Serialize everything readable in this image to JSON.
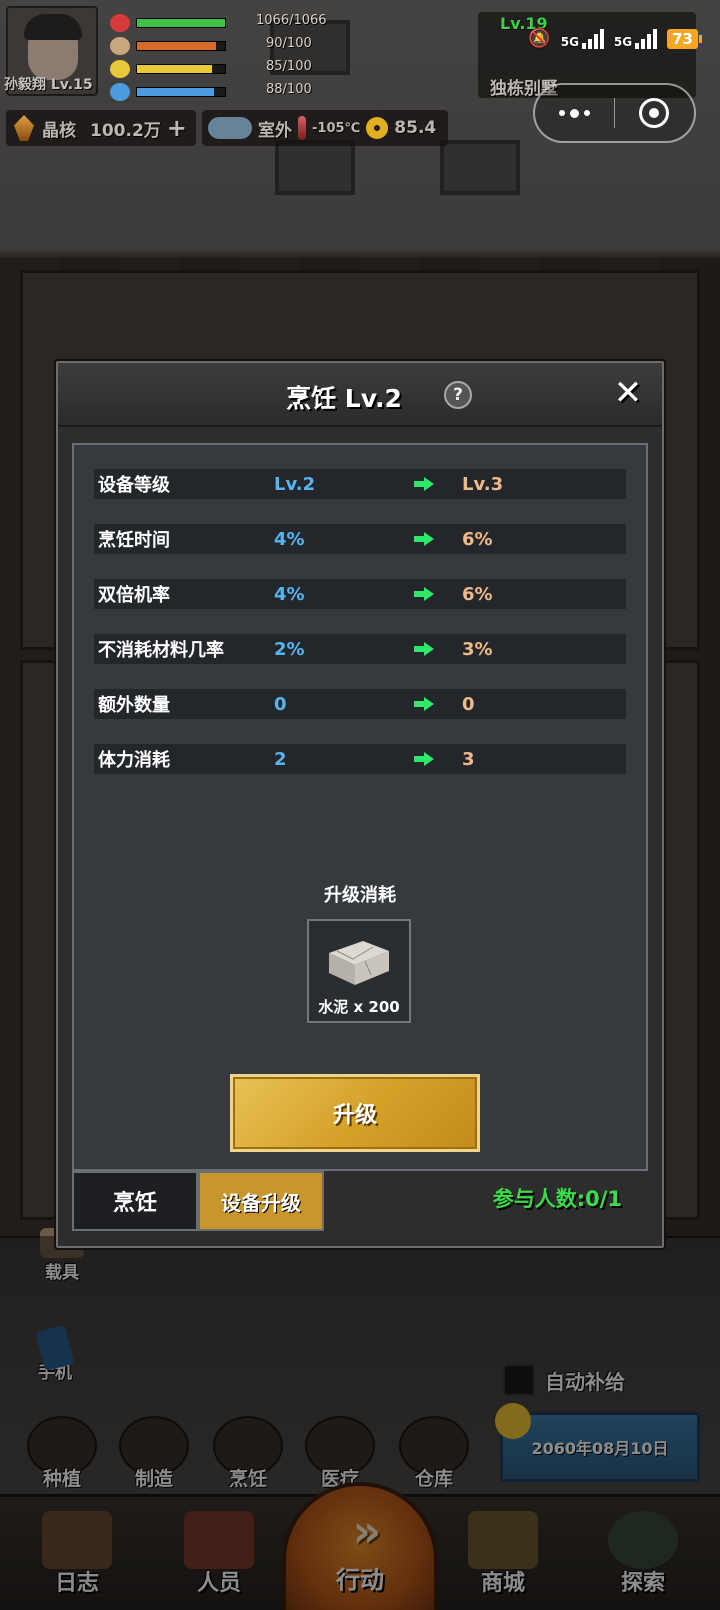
{
  "hud": {
    "player_name": "孙毅翔 Lv.15",
    "hp": "1066/1066",
    "hunger": "90/100",
    "energy": "85/100",
    "water": "88/100",
    "hp_level": 1.0,
    "hunger_level": 0.9,
    "energy_level": 0.85,
    "water_level": 0.88,
    "crystal_label": "晶核",
    "crystal_value": "100.2万",
    "crystal_add": "+",
    "location": "室外",
    "temperature": "-105℃",
    "radiation": "85.4",
    "base_level": "Lv.19",
    "base_name": "独栋别墅"
  },
  "system": {
    "network_1": "5G",
    "network_2": "5G",
    "battery": "73"
  },
  "modal": {
    "title": "烹饪 Lv.2",
    "help_label": "?",
    "close_label": "✕",
    "attributes": [
      {
        "label": "设备等级",
        "current": "Lv.2",
        "next": "Lv.3"
      },
      {
        "label": "烹饪时间",
        "current": "4%",
        "next": "6%"
      },
      {
        "label": "双倍机率",
        "current": "4%",
        "next": "6%"
      },
      {
        "label": "不消耗材料几率",
        "current": "2%",
        "next": "3%"
      },
      {
        "label": "额外数量",
        "current": "0",
        "next": "0"
      },
      {
        "label": "体力消耗",
        "current": "2",
        "next": "3"
      }
    ],
    "cost_title": "升级消耗",
    "cost_item_label": "水泥 x 200",
    "upgrade_label": "升级",
    "tabs": [
      "烹饪",
      "设备升级"
    ],
    "participants": "参与人数:0/1"
  },
  "side": {
    "vehicle": "载具",
    "phone": "手机",
    "auto_supply": "自动补给",
    "date": "2060年08月10日"
  },
  "quick": [
    "种植",
    "制造",
    "烹饪",
    "医疗",
    "仓库"
  ],
  "nav": {
    "log": "日志",
    "people": "人员",
    "action": "行动",
    "action_icon": "»",
    "shop": "商城",
    "explore": "探索"
  },
  "colors": {
    "current_value": "#58b4ee",
    "next_value": "#f0b98a",
    "arrow": "#2ee86a",
    "participants": "#3bdc4a",
    "upgrade_button": "#d4a028"
  }
}
